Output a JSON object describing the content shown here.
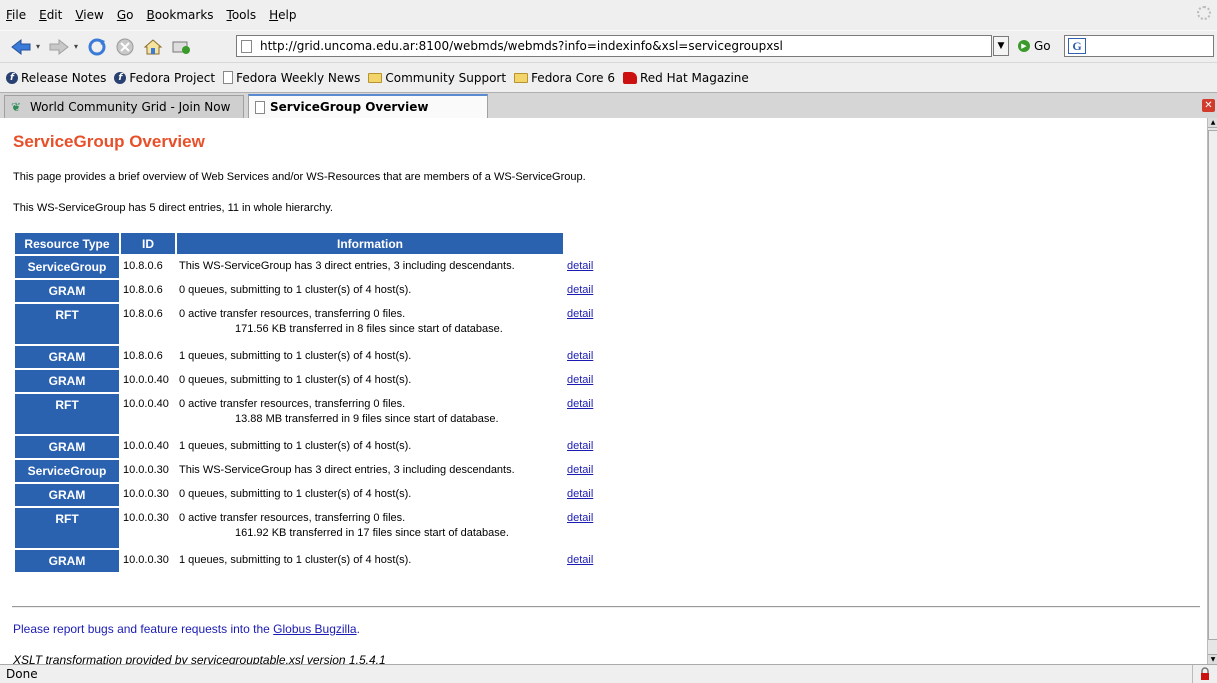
{
  "menu": [
    "File",
    "Edit",
    "View",
    "Go",
    "Bookmarks",
    "Tools",
    "Help"
  ],
  "menu_mnemonic": [
    "F",
    "E",
    "V",
    "G",
    "B",
    "T",
    "H"
  ],
  "address": {
    "url": "http://grid.uncoma.edu.ar:8100/webmds/webmds?info=indexinfo&xsl=servicegroupxsl",
    "go_label": "Go",
    "search_icon": "G"
  },
  "bookmarks": [
    {
      "label": "Release Notes",
      "icon": "fedora-icon"
    },
    {
      "label": "Fedora Project",
      "icon": "fedora-icon"
    },
    {
      "label": "Fedora Weekly News",
      "icon": "page-icon"
    },
    {
      "label": "Community Support",
      "icon": "folder-icon"
    },
    {
      "label": "Fedora Core 6",
      "icon": "folder-icon"
    },
    {
      "label": "Red Hat Magazine",
      "icon": "redhat-icon"
    }
  ],
  "tabs": [
    {
      "label": "World Community Grid - Join Now",
      "active": false
    },
    {
      "label": "ServiceGroup Overview",
      "active": true
    }
  ],
  "page": {
    "title": "ServiceGroup Overview",
    "intro": "This page provides a brief overview of Web Services and/or WS-Resources that are members of a WS-ServiceGroup.",
    "summary": "This WS-ServiceGroup has 5 direct entries, 11 in whole hierarchy.",
    "table": {
      "headers": [
        "Resource Type",
        "ID",
        "Information"
      ],
      "rows": [
        {
          "type": "ServiceGroup",
          "id": "10.8.0.6",
          "info": "This WS-ServiceGroup has 3 direct entries, 3 including descendants.",
          "info2": "",
          "link": "detail"
        },
        {
          "type": "GRAM",
          "id": "10.8.0.6",
          "info": "0 queues, submitting to 1 cluster(s) of 4 host(s).",
          "info2": "",
          "link": "detail"
        },
        {
          "type": "RFT",
          "id": "10.8.0.6",
          "info": "0 active transfer resources, transferring 0 files.",
          "info2": "171.56 KB transferred in 8 files since start of database.",
          "link": "detail"
        },
        {
          "type": "GRAM",
          "id": "10.8.0.6",
          "info": "1 queues, submitting to 1 cluster(s) of 4 host(s).",
          "info2": "",
          "link": "detail"
        },
        {
          "type": "GRAM",
          "id": "10.0.0.40",
          "info": "0 queues, submitting to 1 cluster(s) of 4 host(s).",
          "info2": "",
          "link": "detail"
        },
        {
          "type": "RFT",
          "id": "10.0.0.40",
          "info": "0 active transfer resources, transferring 0 files.",
          "info2": "13.88 MB transferred in 9 files since start of database.",
          "link": "detail"
        },
        {
          "type": "GRAM",
          "id": "10.0.0.40",
          "info": "1 queues, submitting to 1 cluster(s) of 4 host(s).",
          "info2": "",
          "link": "detail"
        },
        {
          "type": "ServiceGroup",
          "id": "10.0.0.30",
          "info": "This WS-ServiceGroup has 3 direct entries, 3 including descendants.",
          "info2": "",
          "link": "detail"
        },
        {
          "type": "GRAM",
          "id": "10.0.0.30",
          "info": "0 queues, submitting to 1 cluster(s) of 4 host(s).",
          "info2": "",
          "link": "detail"
        },
        {
          "type": "RFT",
          "id": "10.0.0.30",
          "info": "0 active transfer resources, transferring 0 files.",
          "info2": "161.92 KB transferred in 17 files since start of database.",
          "link": "detail"
        },
        {
          "type": "GRAM",
          "id": "10.0.0.30",
          "info": "1 queues, submitting to 1 cluster(s) of 4 host(s).",
          "info2": "",
          "link": "detail"
        }
      ]
    },
    "report_prefix": "Please report bugs and feature requests into the ",
    "report_link": "Globus Bugzilla",
    "report_suffix": ".",
    "xslt": "XSLT transformation provided by servicegrouptable.xsl version 1.5.4.1"
  },
  "status": "Done",
  "colors": {
    "title": "#e8502a",
    "header_bg": "#2b62b0",
    "link": "#1b1bb3"
  }
}
